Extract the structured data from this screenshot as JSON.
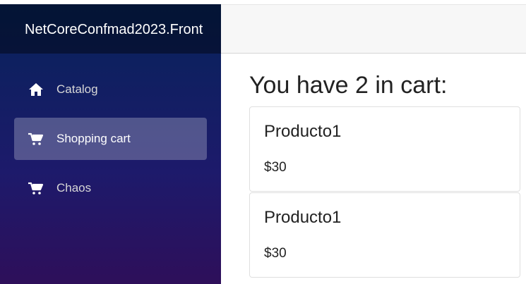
{
  "app": {
    "brand": "NetCoreConfmad2023.Front"
  },
  "sidebar": {
    "items": [
      {
        "label": "Catalog",
        "icon": "home-icon",
        "active": false
      },
      {
        "label": "Shopping cart",
        "icon": "cart-icon",
        "active": true
      },
      {
        "label": "Chaos",
        "icon": "cart-icon",
        "active": false
      }
    ]
  },
  "main": {
    "heading": "You have 2 in cart:",
    "cart_items": [
      {
        "name": "Producto1",
        "price": "$30"
      },
      {
        "name": "Producto1",
        "price": "$30"
      }
    ]
  },
  "colors": {
    "sidebar_top": "#06235a",
    "sidebar_bottom": "#2e0f5a",
    "topbar": "#f7f7f7",
    "active_item": "rgba(255,255,255,0.25)"
  }
}
